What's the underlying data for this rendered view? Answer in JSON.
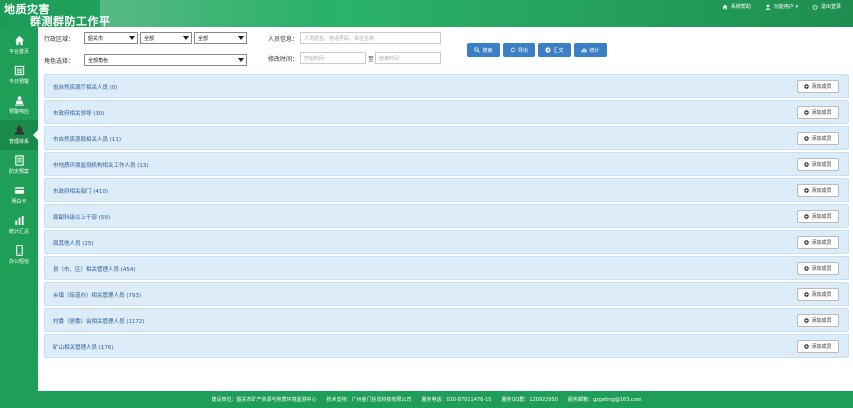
{
  "header": {
    "title_line1": "地质灾害",
    "title_line2": "群测群防工作平台",
    "links": [
      {
        "icon": "home-icon",
        "label": "系统帮助"
      },
      {
        "icon": "user-icon",
        "label": "功能用户 ▾"
      },
      {
        "icon": "power-icon",
        "label": "退出登录"
      }
    ]
  },
  "sidebar": {
    "items": [
      {
        "icon": "home-icon",
        "label": "平台首页"
      },
      {
        "icon": "calendar-icon",
        "label": "今日预警"
      },
      {
        "icon": "alert-response-icon",
        "label": "预警响应"
      },
      {
        "icon": "management-icon",
        "label": "管理体系"
      },
      {
        "icon": "plan-icon",
        "label": "防灾预案"
      },
      {
        "icon": "card-icon",
        "label": "明白卡"
      },
      {
        "icon": "bar-chart-icon",
        "label": "统计汇总"
      },
      {
        "icon": "phone-icon",
        "label": "办公短信"
      }
    ]
  },
  "filters": {
    "region_label": "行政区域：",
    "region_city": "韶关市",
    "region_county": "全部",
    "region_town": "全部",
    "role_label": "角色选择：",
    "role_value": "全部角色",
    "person_label": "人员信息：",
    "person_placeholder": "人员姓名、电话号码、单位名称",
    "time_label": "修改时间：",
    "time_start_placeholder": "开始时间",
    "time_sep": "至",
    "time_end_placeholder": "结束时间",
    "buttons": {
      "search": "搜索",
      "export": "导出",
      "summary": "汇交",
      "stats": "统计"
    }
  },
  "groups": [
    {
      "title": "省自然资源厅相关人员 (0)"
    },
    {
      "title": "市政府相关领导 (30)"
    },
    {
      "title": "市自然资源局相关人员 (11)"
    },
    {
      "title": "市地质环境监测机构相关工作人员 (13)"
    },
    {
      "title": "市政府相关部门 (410)"
    },
    {
      "title": "局副科级以上干部 (59)"
    },
    {
      "title": "局其他人员 (25)"
    },
    {
      "title": "县（市、区）相关管理人员 (454)"
    },
    {
      "title": "乡镇（街道办）相关管理人员 (793)"
    },
    {
      "title": "村委（居委）会相关管理人员 (1172)"
    },
    {
      "title": "矿山相关管理人员 (176)"
    }
  ],
  "add_member_label": "添加成员",
  "footer": {
    "org": "建设单位：韶关市矿产资源与地质环境监测中心",
    "support": "技术支持：广州金门信息科技有限公司",
    "phone": "服务电话：020-87011476-15",
    "qq": "服务QQ群：120922950",
    "email": "服务邮箱：gzgeting@163.com"
  },
  "colors": {
    "brand_green": "#1f9e57",
    "button_blue": "#3b7fc4",
    "group_bg": "#dcecf9",
    "group_text": "#2a5d9c"
  }
}
